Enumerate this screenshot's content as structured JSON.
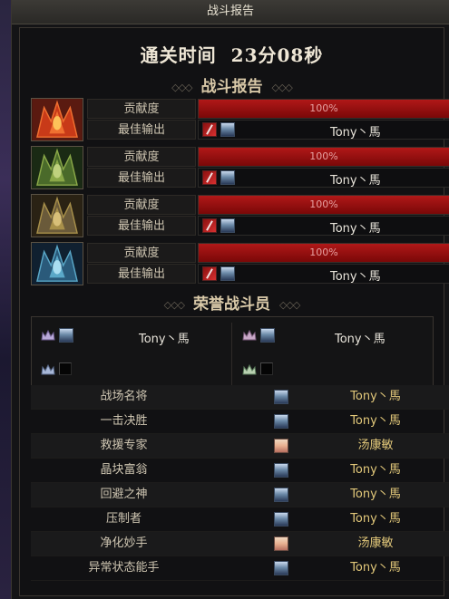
{
  "window_title": "战斗报告",
  "clear_time": {
    "label": "通关时间",
    "value": "23分08秒"
  },
  "report_title": "战斗报告",
  "bosses": [
    {
      "icon": "red-boss-icon",
      "contribution_label": "贡献度",
      "contribution_value": "100%",
      "contribution_fraction": 1.0,
      "best_label": "最佳输出",
      "best_player": "Tony丶馬"
    },
    {
      "icon": "green-boss-icon",
      "contribution_label": "贡献度",
      "contribution_value": "100%",
      "contribution_fraction": 1.0,
      "best_label": "最佳输出",
      "best_player": "Tony丶馬"
    },
    {
      "icon": "gold-boss-icon",
      "contribution_label": "贡献度",
      "contribution_value": "100%",
      "contribution_fraction": 1.0,
      "best_label": "最佳输出",
      "best_player": "Tony丶馬"
    },
    {
      "icon": "blue-boss-icon",
      "contribution_label": "贡献度",
      "contribution_value": "100%",
      "contribution_fraction": 1.0,
      "best_label": "最佳输出",
      "best_player": "Tony丶馬"
    }
  ],
  "honor_title": "荣誉战斗员",
  "honor": [
    {
      "player": "Tony丶馬"
    },
    {
      "player": "Tony丶馬"
    },
    {
      "player": ""
    },
    {
      "player": ""
    }
  ],
  "awards": [
    {
      "title": "战场名将",
      "player": "Tony丶馬",
      "avatar": "male"
    },
    {
      "title": "一击决胜",
      "player": "Tony丶馬",
      "avatar": "male"
    },
    {
      "title": "救援专家",
      "player": "汤康敏",
      "avatar": "female"
    },
    {
      "title": "晶块富翁",
      "player": "Tony丶馬",
      "avatar": "male"
    },
    {
      "title": "回避之神",
      "player": "Tony丶馬",
      "avatar": "male"
    },
    {
      "title": "压制者",
      "player": "Tony丶馬",
      "avatar": "male"
    },
    {
      "title": "净化妙手",
      "player": "汤康敏",
      "avatar": "female"
    },
    {
      "title": "异常状态能手",
      "player": "Tony丶馬",
      "avatar": "male"
    }
  ],
  "colors": {
    "bar": "#a01010",
    "award_player": "#e2c87a"
  }
}
